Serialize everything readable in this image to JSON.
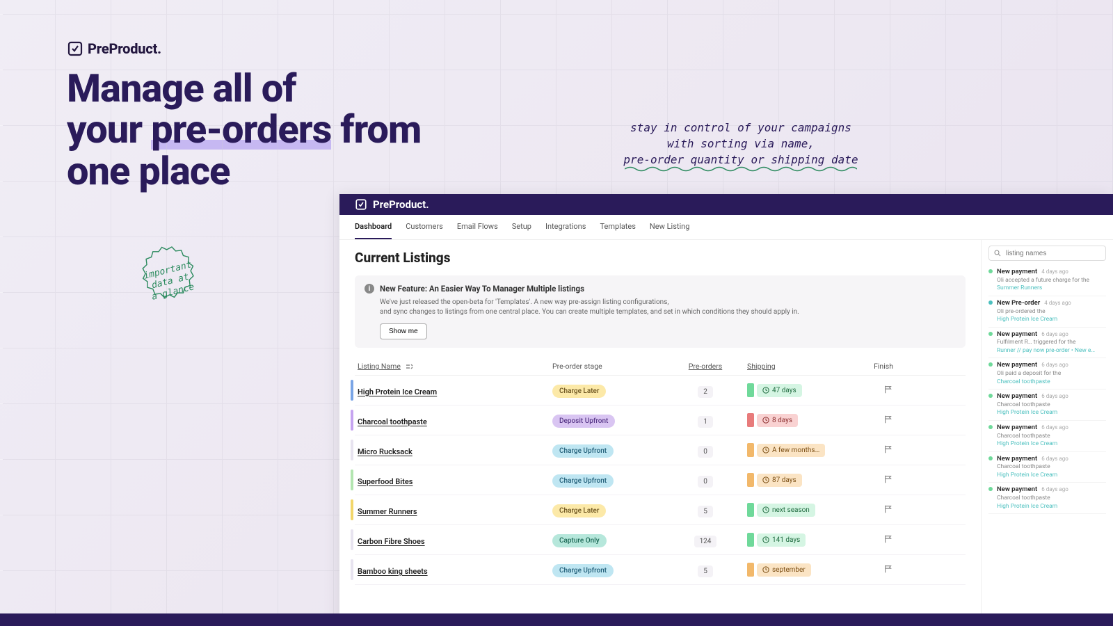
{
  "brand": "PreProduct.",
  "headline": {
    "l1": "Manage all of",
    "l2a": "your ",
    "l2b": "pre-orders",
    "l2c": " from",
    "l3": "one place"
  },
  "tagline": {
    "l1": "stay in control of your campaigns",
    "l2": "with sorting via name,",
    "l3": "pre-order quantity or shipping date"
  },
  "stamp": {
    "l1": "important",
    "l2": "data at",
    "l3": "a glance"
  },
  "nav": [
    "Dashboard",
    "Customers",
    "Email Flows",
    "Setup",
    "Integrations",
    "Templates",
    "New Listing"
  ],
  "dash_title": "Current Listings",
  "feature": {
    "title": "New Feature: An Easier Way To Manager Multiple listings",
    "body1": "We've just released the open-beta for 'Templates'. A new way pre-assign listing configurations,",
    "body2": "and sync changes to listings from one central place.  You can create multiple templates, and set in which conditions they should apply in.",
    "button": "Show me"
  },
  "cols": {
    "name": "Listing Name",
    "stage": "Pre-order stage",
    "pre": "Pre-orders",
    "ship": "Shipping",
    "finish": "Finish"
  },
  "listings": [
    {
      "acc": "#7aa5e6",
      "name": "High Protein Ice Cream",
      "stage": "Charge Later",
      "stageClass": "pill-yellow",
      "count": "2",
      "barClass": "bar-green",
      "shipClass": "sp-green",
      "ship": "47 days"
    },
    {
      "acc": "#c6a4f0",
      "name": "Charcoal toothpaste",
      "stage": "Deposit Upfront",
      "stageClass": "pill-purple",
      "count": "1",
      "barClass": "bar-red",
      "shipClass": "sp-red",
      "ship": "8 days"
    },
    {
      "acc": "#e7e3ef",
      "name": "Micro Rucksack",
      "stage": "Charge Upfront",
      "stageClass": "pill-blue",
      "count": "0",
      "barClass": "bar-orange",
      "shipClass": "sp-orange",
      "ship": "A few months…"
    },
    {
      "acc": "#b3e5b0",
      "name": "Superfood Bites",
      "stage": "Charge Upfront",
      "stageClass": "pill-blue",
      "count": "0",
      "barClass": "bar-orange",
      "shipClass": "sp-orange",
      "ship": "87 days"
    },
    {
      "acc": "#f2d66a",
      "name": "Summer Runners",
      "stage": "Charge Later",
      "stageClass": "pill-yellow",
      "count": "5",
      "barClass": "bar-green",
      "shipClass": "sp-green",
      "ship": "next season"
    },
    {
      "acc": "#e7e3ef",
      "name": "Carbon Fibre Shoes",
      "stage": "Capture Only",
      "stageClass": "pill-teal",
      "count": "124",
      "barClass": "bar-green",
      "shipClass": "sp-green",
      "ship": "141 days"
    },
    {
      "acc": "#e7e3ef",
      "name": "Bamboo king sheets",
      "stage": "Charge Upfront",
      "stageClass": "pill-blue",
      "count": "5",
      "barClass": "bar-orange",
      "shipClass": "sp-orange",
      "ship": "september"
    }
  ],
  "search_placeholder": "listing names",
  "feed": [
    {
      "dot": "dot-green",
      "title": "New payment",
      "time": "4 days ago",
      "body": "Oli accepted a future charge for the",
      "link": "Summer Runners"
    },
    {
      "dot": "dot-teal",
      "title": "New Pre-order",
      "time": "4 days ago",
      "body": "Oli pre-ordered the",
      "link": "High Protein Ice Cream"
    },
    {
      "dot": "dot-green",
      "title": "New payment",
      "time": "6 days ago",
      "body": "Fulfilment R… triggered for the",
      "link": "Runner // pay now pre-order • New e…"
    },
    {
      "dot": "dot-green",
      "title": "New payment",
      "time": "6 days ago",
      "body": "Oli paid a deposit for the",
      "link": "Charcoal toothpaste"
    },
    {
      "dot": "dot-green",
      "title": "New payment",
      "time": "6 days ago",
      "body": "Charcoal toothpaste",
      "link": "High Protein Ice Cream"
    },
    {
      "dot": "dot-green",
      "title": "New payment",
      "time": "6 days ago",
      "body": "Charcoal toothpaste",
      "link": "High Protein Ice Cream"
    },
    {
      "dot": "dot-green",
      "title": "New payment",
      "time": "6 days ago",
      "body": "Charcoal toothpaste",
      "link": "High Protein Ice Cream"
    },
    {
      "dot": "dot-green",
      "title": "New payment",
      "time": "6 days ago",
      "body": "Charcoal toothpaste",
      "link": "High Protein Ice Cream"
    }
  ]
}
